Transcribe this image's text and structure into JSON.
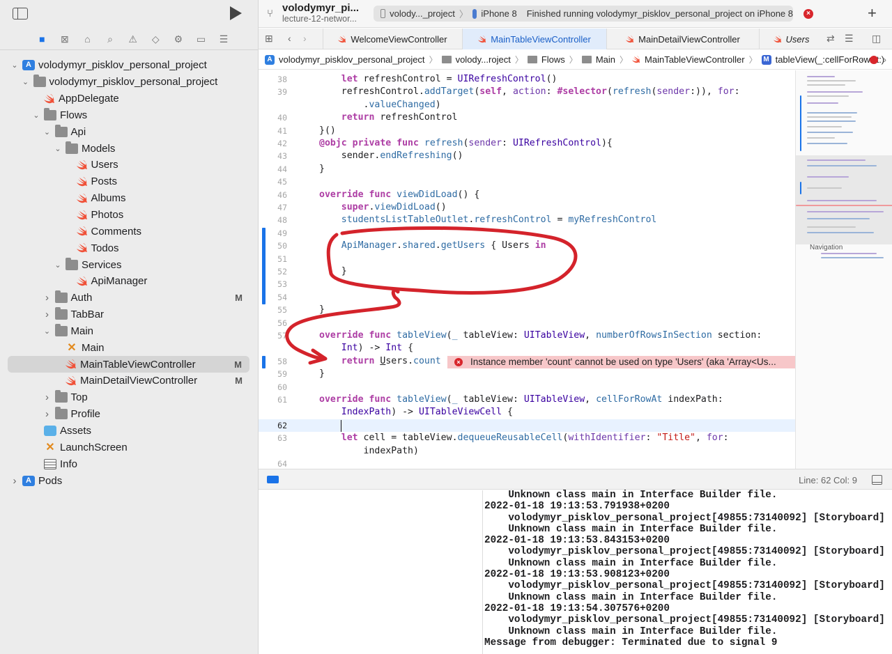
{
  "sidebar": {
    "tree": [
      {
        "label": "volodymyr_pisklov_personal_project",
        "indent": 0,
        "chev": "down",
        "icon": "proj",
        "badge": ""
      },
      {
        "label": "volodymyr_pisklov_personal_project",
        "indent": 1,
        "chev": "down",
        "icon": "folder",
        "badge": ""
      },
      {
        "label": "AppDelegate",
        "indent": 2,
        "chev": "",
        "icon": "swift",
        "badge": ""
      },
      {
        "label": "Flows",
        "indent": 2,
        "chev": "down",
        "icon": "folder",
        "badge": ""
      },
      {
        "label": "Api",
        "indent": 3,
        "chev": "down",
        "icon": "folder",
        "badge": ""
      },
      {
        "label": "Models",
        "indent": 4,
        "chev": "down",
        "icon": "folder",
        "badge": ""
      },
      {
        "label": "Users",
        "indent": 5,
        "chev": "",
        "icon": "swift",
        "badge": ""
      },
      {
        "label": "Posts",
        "indent": 5,
        "chev": "",
        "icon": "swift",
        "badge": ""
      },
      {
        "label": "Albums",
        "indent": 5,
        "chev": "",
        "icon": "swift",
        "badge": ""
      },
      {
        "label": "Photos",
        "indent": 5,
        "chev": "",
        "icon": "swift",
        "badge": ""
      },
      {
        "label": "Comments",
        "indent": 5,
        "chev": "",
        "icon": "swift",
        "badge": ""
      },
      {
        "label": "Todos",
        "indent": 5,
        "chev": "",
        "icon": "swift",
        "badge": ""
      },
      {
        "label": "Services",
        "indent": 4,
        "chev": "down",
        "icon": "folder",
        "badge": ""
      },
      {
        "label": "ApiManager",
        "indent": 5,
        "chev": "",
        "icon": "swift",
        "badge": ""
      },
      {
        "label": "Auth",
        "indent": 3,
        "chev": "right",
        "icon": "folder",
        "badge": "M"
      },
      {
        "label": "TabBar",
        "indent": 3,
        "chev": "right",
        "icon": "folder",
        "badge": ""
      },
      {
        "label": "Main",
        "indent": 3,
        "chev": "down",
        "icon": "folder",
        "badge": ""
      },
      {
        "label": "Main",
        "indent": 4,
        "chev": "",
        "icon": "xib",
        "badge": ""
      },
      {
        "label": "MainTableViewController",
        "indent": 4,
        "chev": "",
        "icon": "swift",
        "badge": "M",
        "selected": true
      },
      {
        "label": "MainDetailViewController",
        "indent": 4,
        "chev": "",
        "icon": "swift",
        "badge": "M"
      },
      {
        "label": "Top",
        "indent": 3,
        "chev": "right",
        "icon": "folder",
        "badge": ""
      },
      {
        "label": "Profile",
        "indent": 3,
        "chev": "right",
        "icon": "folder",
        "badge": ""
      },
      {
        "label": "Assets",
        "indent": 2,
        "chev": "",
        "icon": "assets",
        "badge": ""
      },
      {
        "label": "LaunchScreen",
        "indent": 2,
        "chev": "",
        "icon": "xib",
        "badge": ""
      },
      {
        "label": "Info",
        "indent": 2,
        "chev": "",
        "icon": "plist",
        "badge": ""
      },
      {
        "label": "Pods",
        "indent": 0,
        "chev": "right",
        "icon": "proj",
        "badge": ""
      }
    ]
  },
  "titlebar": {
    "project": "volodymyr_pi...",
    "branch": "lecture-12-networ...",
    "scheme": "volody..._project",
    "device": "iPhone 8",
    "status": "Finished running volodymyr_pisklov_personal_project on iPhone 8"
  },
  "tabs": [
    {
      "label": "WelcomeViewController"
    },
    {
      "label": "MainTableViewController"
    },
    {
      "label": "MainDetailViewController"
    },
    {
      "label": "Users"
    }
  ],
  "jumpbar": {
    "items": [
      "volodymyr_pisklov_personal_project",
      "volody...roject",
      "Flows",
      "Main",
      "MainTableViewController",
      "tableView(_:cellForRowAt:)"
    ]
  },
  "editor": {
    "lines": [
      {
        "n": "38",
        "html": "    <span class=\"kw\">let</span> refreshControl = <span class=\"ty\">UIRefreshControl</span>()"
      },
      {
        "n": "39",
        "html": "    refreshControl.<span class=\"fn\">addTarget</span>(<span class=\"kw\">self</span>, <span class=\"param\">action</span>: <span class=\"kw\">#selector</span>(<span class=\"fn\">refresh</span>(<span class=\"param\">sender</span>:)), <span class=\"param\">for</span>:"
      },
      {
        "n": "",
        "html": "        .<span class=\"fn\">valueChanged</span>)"
      },
      {
        "n": "40",
        "html": "    <span class=\"kw\">return</span> refreshControl"
      },
      {
        "n": "41",
        "html": "}()"
      },
      {
        "n": "42",
        "html": "<span class=\"kw\">@objc private func</span> <span class=\"fn\">refresh</span>(<span class=\"param\">sender</span>: <span class=\"ty\">UIRefreshControl</span>){"
      },
      {
        "n": "43",
        "html": "    sender.<span class=\"fn\">endRefreshing</span>()"
      },
      {
        "n": "44",
        "html": "}"
      },
      {
        "n": "45",
        "html": ""
      },
      {
        "n": "46",
        "html": "<span class=\"kw\">override func</span> <span class=\"fn\">viewDidLoad</span>() {"
      },
      {
        "n": "47",
        "html": "    <span class=\"kw\">super</span>.<span class=\"fn\">viewDidLoad</span>()"
      },
      {
        "n": "48",
        "html": "    <span class=\"fn\">studentsListTableOutlet</span>.<span class=\"fn\">refreshControl</span> = <span class=\"fn\">myRefreshControl</span>"
      },
      {
        "n": "49",
        "html": ""
      },
      {
        "n": "50",
        "html": "    <span class=\"fn\">ApiManager</span>.<span class=\"fn\">shared</span>.<span class=\"fn\">getUsers</span> { Users <span class=\"kw\">in</span>"
      },
      {
        "n": "51",
        "html": ""
      },
      {
        "n": "52",
        "html": "    }"
      },
      {
        "n": "53",
        "html": ""
      },
      {
        "n": "54",
        "html": ""
      },
      {
        "n": "55",
        "html": "}"
      },
      {
        "n": "56",
        "html": ""
      },
      {
        "n": "57",
        "html": "<span class=\"kw\">override func</span> <span class=\"fn\">tableView</span>(<span class=\"fn\">_</span> tableView: <span class=\"ty\">UITableView</span>, <span class=\"fn\">numberOfRowsInSection</span> section:"
      },
      {
        "n": "",
        "html": "    <span class=\"ty\">Int</span>) -> <span class=\"ty\">Int</span> {"
      },
      {
        "n": "58",
        "html": "    <span class=\"kw\">return</span> <u>U</u>sers.<span class=\"fn\">count</span>"
      },
      {
        "n": "59",
        "html": "}"
      },
      {
        "n": "60",
        "html": ""
      },
      {
        "n": "61",
        "html": "<span class=\"kw\">override func</span> <span class=\"fn\">tableView</span>(<span class=\"fn\">_</span> tableView: <span class=\"ty\">UITableView</span>, <span class=\"fn\">cellForRowAt</span> indexPath:"
      },
      {
        "n": "",
        "html": "    <span class=\"ty\">IndexPath</span>) -> <span class=\"ty\">UITableViewCell</span> {"
      },
      {
        "n": "62",
        "html": ""
      },
      {
        "n": "63",
        "html": "    <span class=\"kw\">let</span> cell = tableView.<span class=\"fn\">dequeueReusableCell</span>(<span class=\"param\">withIdentifier</span>: <span class=\"str\">\"Title\"</span>, <span class=\"param\">for</span>:"
      },
      {
        "n": "",
        "html": "        indexPath)"
      },
      {
        "n": "64",
        "html": ""
      }
    ],
    "error_message": "Instance member 'count' cannot be used on type 'Users' (aka 'Array<Us...",
    "minimap_label": "Navigation"
  },
  "status": {
    "line_col": "Line: 62  Col: 9"
  },
  "console": {
    "text": "    Unknown class main in Interface Builder file.\n2022-01-18 19:13:53.791938+0200\n    volodymyr_pisklov_personal_project[49855:73140092] [Storyboard]\n    Unknown class main in Interface Builder file.\n2022-01-18 19:13:53.843153+0200\n    volodymyr_pisklov_personal_project[49855:73140092] [Storyboard]\n    Unknown class main in Interface Builder file.\n2022-01-18 19:13:53.908123+0200\n    volodymyr_pisklov_personal_project[49855:73140092] [Storyboard]\n    Unknown class main in Interface Builder file.\n2022-01-18 19:13:54.307576+0200\n    volodymyr_pisklov_personal_project[49855:73140092] [Storyboard]\n    Unknown class main in Interface Builder file.\nMessage from debugger: Terminated due to signal 9"
  },
  "colors": {
    "accent": "#1a73e8",
    "error": "#d8262c",
    "annotation": "#d4232b"
  }
}
